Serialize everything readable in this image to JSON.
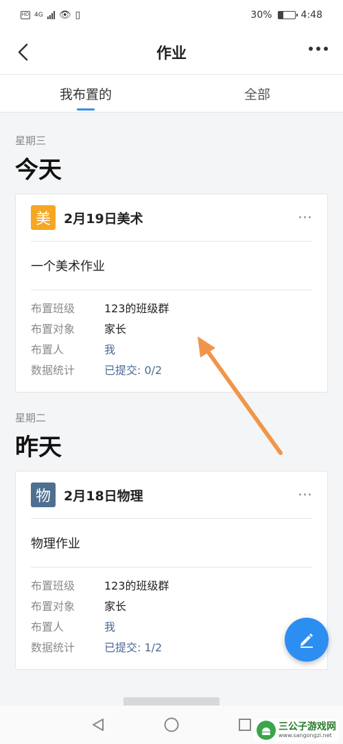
{
  "status_bar": {
    "left_badge": "HD",
    "network": "4G",
    "battery": "30%",
    "time": "4:48",
    "battery_level": 0.3
  },
  "header": {
    "title": "作业",
    "back_icon": "chevron-left-icon",
    "more_icon": "more-horizontal-icon"
  },
  "tabs": [
    {
      "label": "我布置的",
      "active": true
    },
    {
      "label": "全部",
      "active": false
    }
  ],
  "sections": [
    {
      "weekday": "星期三",
      "day": "今天",
      "card": {
        "badge": "美",
        "badge_color": "#f5a623",
        "title": "2月19日美术",
        "description": "一个美术作业",
        "rows": [
          {
            "label": "布置班级",
            "value": "123的班级群"
          },
          {
            "label": "布置对象",
            "value": "家长"
          },
          {
            "label": "布置人",
            "value": "我"
          },
          {
            "label": "数据统计",
            "value": "已提交: 0/2"
          }
        ]
      }
    },
    {
      "weekday": "星期二",
      "day": "昨天",
      "card": {
        "badge": "物",
        "badge_color": "#4e6f8f",
        "title": "2月18日物理",
        "description": "物理作业",
        "rows": [
          {
            "label": "布置班级",
            "value": "123的班级群"
          },
          {
            "label": "布置对象",
            "value": "家长"
          },
          {
            "label": "布置人",
            "value": "我"
          },
          {
            "label": "数据统计",
            "value": "已提交: 1/2"
          }
        ]
      }
    }
  ],
  "fab": {
    "icon": "pencil-icon",
    "color": "#2d8ef2"
  },
  "annotation": {
    "icon": "arrow-icon",
    "color": "#f0964a"
  },
  "system_nav": [
    "back-triangle-icon",
    "home-circle-icon",
    "recents-square-icon"
  ],
  "watermark": {
    "text": "三公子游戏网",
    "url": "www.sangongzi.net"
  }
}
